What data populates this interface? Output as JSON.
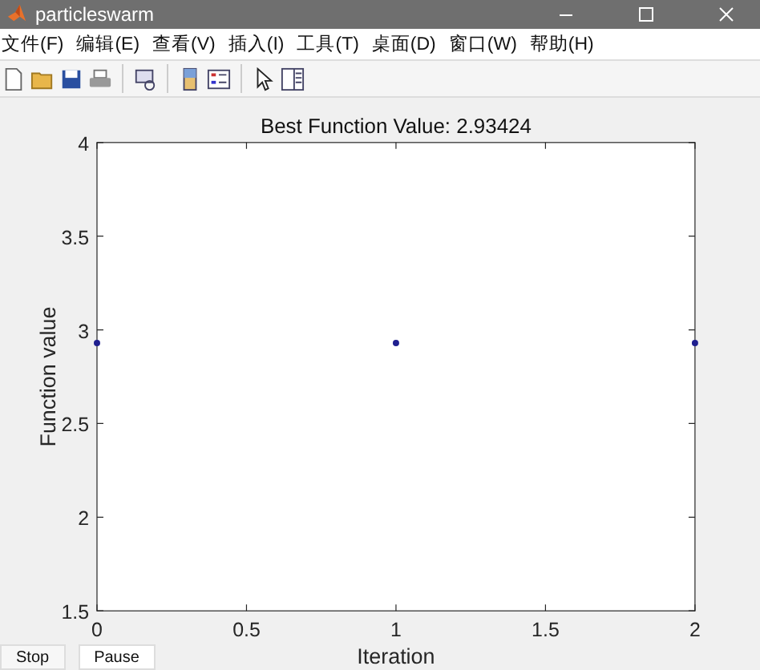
{
  "window": {
    "title": "particleswarm"
  },
  "menu": [
    "文件(F)",
    "编辑(E)",
    "查看(V)",
    "插入(I)",
    "工具(T)",
    "桌面(D)",
    "窗口(W)",
    "帮助(H)"
  ],
  "plot": {
    "chart_data": {
      "type": "scatter",
      "title": "Best Function Value: 2.93424",
      "xlabel": "Iteration",
      "ylabel": "Function value",
      "x": [
        0,
        1,
        2
      ],
      "series": [
        {
          "color": "#1f1f8f",
          "values": [
            2.93,
            2.93,
            2.93
          ]
        }
      ],
      "xlim": [
        0,
        2
      ],
      "ylim": [
        1.5,
        4
      ],
      "xticks": [
        0,
        0.5,
        1,
        1.5,
        2
      ],
      "yticks": [
        1.5,
        2,
        2.5,
        3,
        3.5,
        4
      ]
    }
  },
  "buttons": [
    "Stop",
    "Pause"
  ]
}
